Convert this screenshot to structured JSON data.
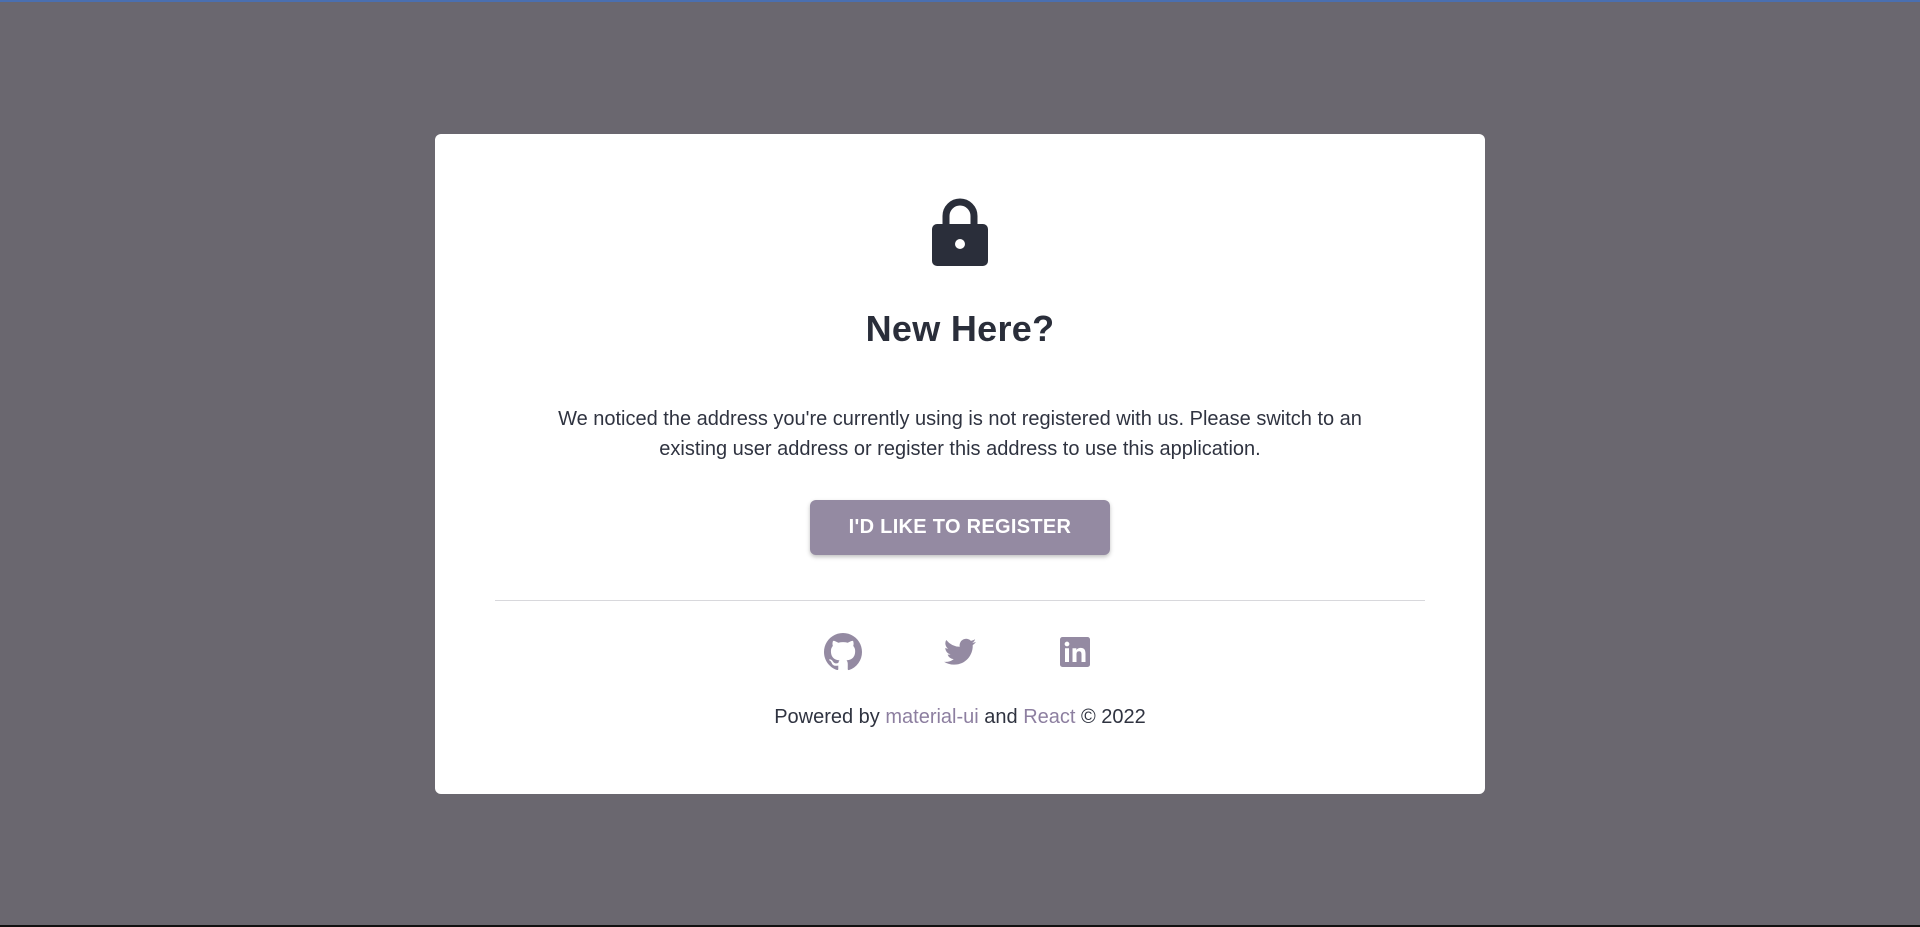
{
  "dialog": {
    "title": "New Here?",
    "message": "We noticed the address you're currently using is not registered with us. Please switch to an existing user address or register this address to use this application.",
    "register_label": "I'D LIKE TO REGISTER"
  },
  "social": {
    "items": [
      {
        "icon": "github-icon"
      },
      {
        "icon": "twitter-icon"
      },
      {
        "icon": "linkedin-icon"
      }
    ]
  },
  "footer": {
    "powered_by": "Powered by ",
    "link_1": "material-ui",
    "and": " and ",
    "link_2": "React",
    "copyright": " © 2022"
  },
  "colors": {
    "background": "#6a676f",
    "accent": "#948aa2",
    "link": "#8d7fa0",
    "text": "#2a2e3a"
  }
}
